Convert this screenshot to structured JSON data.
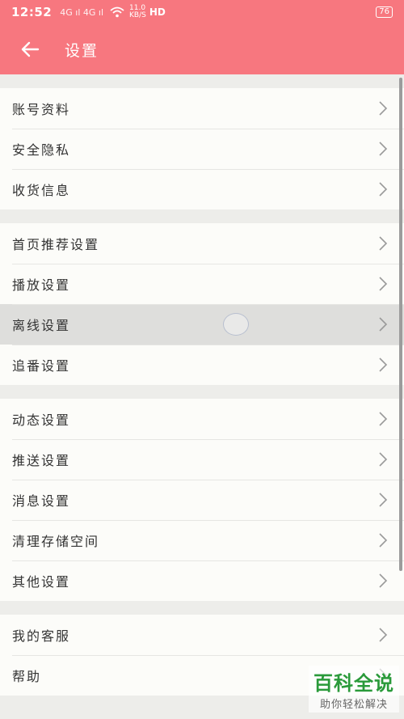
{
  "status_bar": {
    "time": "12:52",
    "signal": "4G ıl 4G ıl",
    "speed_top": "11.0",
    "speed_bottom": "KB/S",
    "hd": "HD",
    "battery": "76"
  },
  "header": {
    "title": "设置"
  },
  "groups": [
    {
      "items": [
        {
          "label": "账号资料"
        },
        {
          "label": "安全隐私"
        },
        {
          "label": "收货信息"
        }
      ]
    },
    {
      "items": [
        {
          "label": "首页推荐设置"
        },
        {
          "label": "播放设置"
        },
        {
          "label": "离线设置"
        },
        {
          "label": "追番设置"
        }
      ]
    },
    {
      "items": [
        {
          "label": "动态设置"
        },
        {
          "label": "推送设置"
        },
        {
          "label": "消息设置"
        },
        {
          "label": "清理存储空间"
        },
        {
          "label": "其他设置"
        }
      ]
    },
    {
      "items": [
        {
          "label": "我的客服"
        },
        {
          "label": "帮助"
        }
      ]
    }
  ],
  "watermark": {
    "main": "百科全说",
    "sub": "助你轻松解决"
  },
  "colors": {
    "accent": "#f7777f",
    "background": "#ededea",
    "row_background": "#fcfcf9",
    "pressed": "#dededc",
    "chevron": "#9a9a9a"
  },
  "icons": [
    "back-arrow-icon",
    "chevron-right-icon",
    "wifi-icon",
    "battery-icon"
  ]
}
